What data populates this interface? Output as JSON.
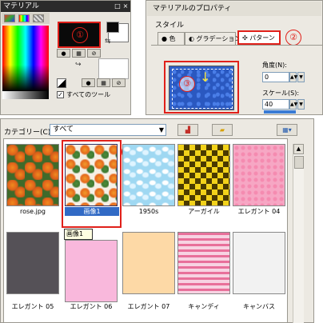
{
  "materials": {
    "title": "マテリアル",
    "title_buttons": [
      "□",
      "×"
    ],
    "marker": "①",
    "all_tools_label": "すべてのツール",
    "all_tools_checked": true
  },
  "properties": {
    "title": "マテリアルのプロパティ",
    "style_label": "スタイル",
    "tabs": [
      {
        "icon": "●",
        "label": "色"
      },
      {
        "icon": "◐",
        "label": "グラデーション"
      },
      {
        "icon": "✣",
        "label": "パターン"
      }
    ],
    "tab_marker": "②",
    "preview_marker": "③",
    "angle_label": "角度(N):",
    "angle_value": "0",
    "scale_label": "スケール(S):",
    "scale_value": "40"
  },
  "browser": {
    "category_label": "カテゴリー(C):",
    "category_value": "すべて",
    "marker": "④",
    "tooltip": "画像1",
    "selected_index": 1,
    "items": [
      {
        "label": "rose.jpg",
        "fill": "p-rose"
      },
      {
        "label": "画像1",
        "fill": "p-gazo"
      },
      {
        "label": "1950s",
        "fill": "p-1950s"
      },
      {
        "label": "アーガイル",
        "fill": "p-argyle"
      },
      {
        "label": "エレガント 04",
        "fill": "p-el04"
      },
      {
        "label": "エレガント 05",
        "fill": "p-el05"
      },
      {
        "label": "エレガント 06",
        "fill": "p-el06"
      },
      {
        "label": "エレガント 07",
        "fill": "p-el07"
      },
      {
        "label": "キャンディ",
        "fill": "p-candy"
      },
      {
        "label": "キャンバス",
        "fill": "p-canvas"
      }
    ]
  }
}
